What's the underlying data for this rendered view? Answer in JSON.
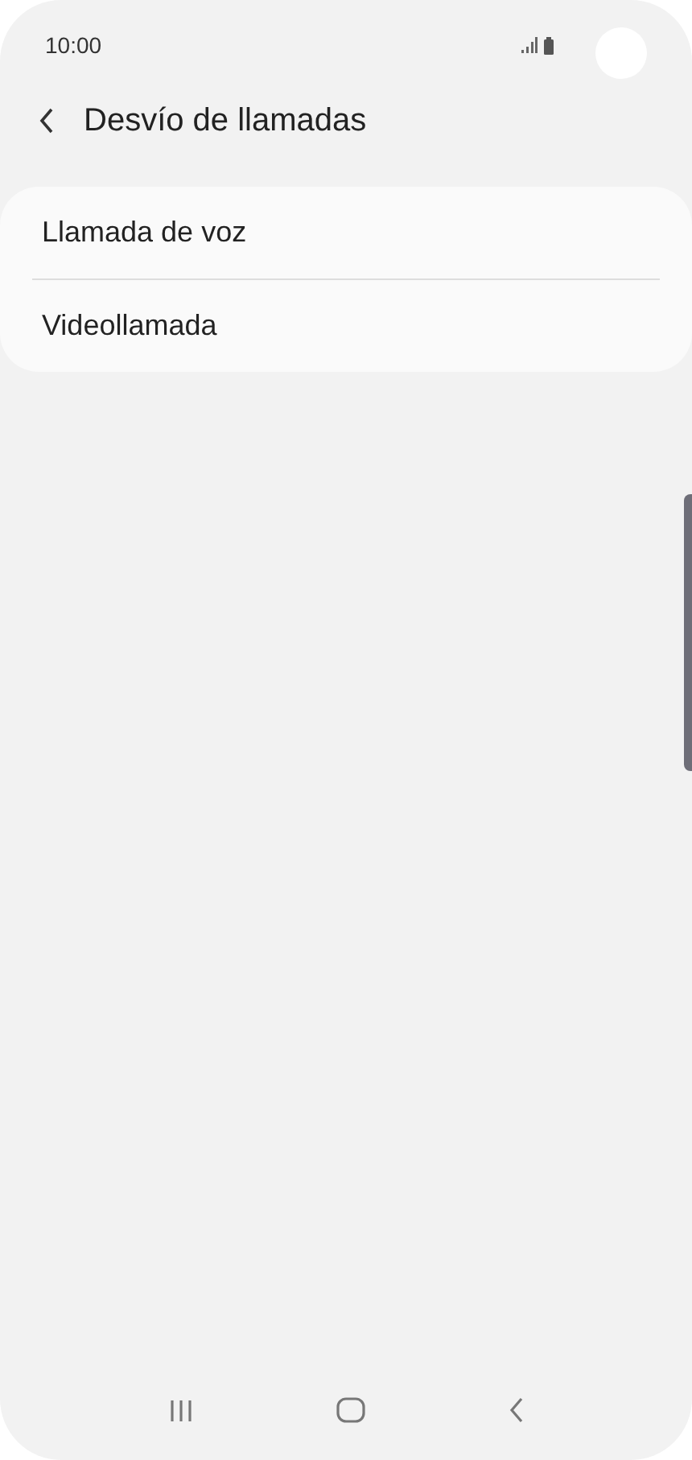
{
  "status_bar": {
    "time": "10:00"
  },
  "header": {
    "title": "Desvío de llamadas"
  },
  "menu_items": [
    {
      "label": "Llamada de voz"
    },
    {
      "label": "Videollamada"
    }
  ]
}
